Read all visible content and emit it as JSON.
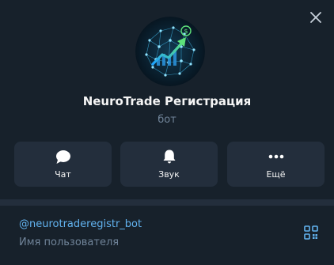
{
  "profile": {
    "name": "NeuroTrade Регистрация",
    "type": "бот"
  },
  "actions": [
    {
      "label": "Чат",
      "icon": "chat-bubble-icon"
    },
    {
      "label": "Звук",
      "icon": "bell-icon"
    },
    {
      "label": "Ещё",
      "icon": "more-dots-icon"
    }
  ],
  "info": {
    "username": "@neurotraderegistr_bot",
    "username_caption": "Имя пользователя"
  },
  "icons": {
    "close": "close-icon",
    "qr": "qr-code-icon",
    "avatar": "bot-avatar-logo"
  },
  "colors": {
    "background": "#17212b",
    "card": "#232e3c",
    "link": "#62b3f0",
    "secondary_text": "#708499",
    "accent": "#5ee17a"
  }
}
